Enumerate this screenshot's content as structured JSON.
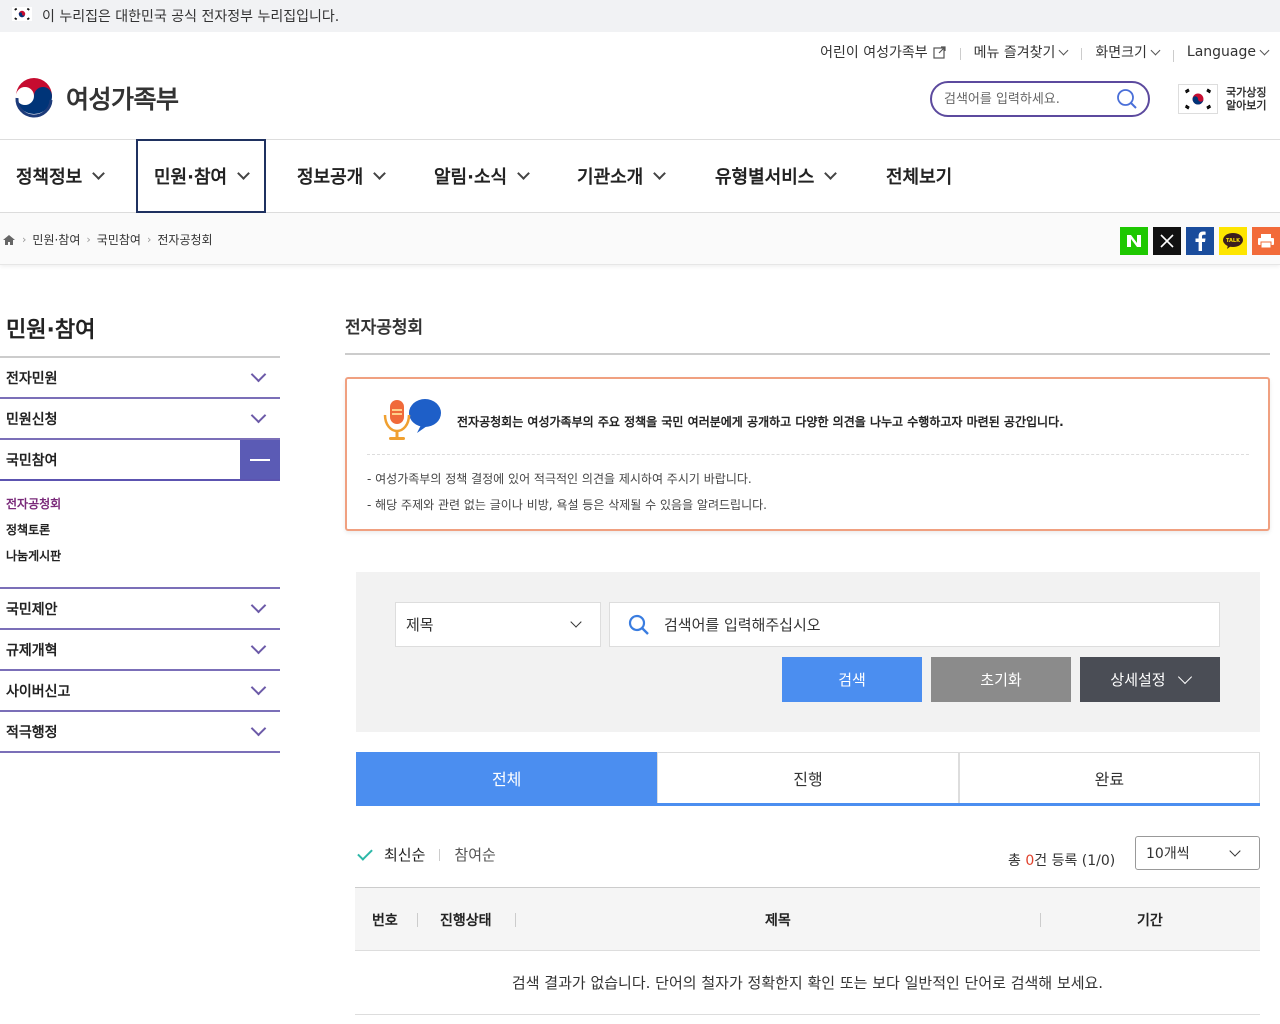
{
  "gov_banner": {
    "text": "이 누리집은 대한민국 공식 전자정부 누리집입니다."
  },
  "utility": {
    "kids": "어린이 여성가족부",
    "favorites": "메뉴 즐겨찾기",
    "screen_size": "화면크기",
    "language": "Language"
  },
  "header": {
    "logo_text": "여성가족부",
    "search_placeholder": "검색어를 입력하세요.",
    "emblem_line1": "국가상징",
    "emblem_line2": "알아보기"
  },
  "gnb": {
    "items": [
      "정책정보",
      "민원·참여",
      "정보공개",
      "알림·소식",
      "기관소개",
      "유형별서비스",
      "전체보기"
    ],
    "active_index": 1
  },
  "breadcrumb": [
    "민원·참여",
    "국민참여",
    "전자공청회"
  ],
  "share_icons": [
    "naver-blog-icon",
    "x-icon",
    "facebook-icon",
    "kakaotalk-icon",
    "print-icon"
  ],
  "lnb": {
    "title": "민원·참여",
    "items": [
      "전자민원",
      "민원신청",
      "국민참여",
      "국민제안",
      "규제개혁",
      "사이버신고",
      "적극행정"
    ],
    "sub_items": [
      "전자공청회",
      "정책토론",
      "나눔게시판"
    ],
    "current_sub": "전자공청회"
  },
  "content": {
    "title": "전자공청회",
    "notice_head": "전자공청회는 여성가족부의 주요 정책을 국민 여러분에게 공개하고 다양한 의견을 나누고 수행하고자 마련된 공간입니다.",
    "notice_line1": "- 여성가족부의 정책 결정에 있어 적극적인 의견을 제시하여 주시기 바랍니다.",
    "notice_line2": "- 해당 주제와 관련 없는 글이나 비방, 욕설 등은 삭제될 수 있음을 알려드립니다."
  },
  "filter": {
    "select_value": "제목",
    "keyword_placeholder": "검색어를 입력해주십시오",
    "search_btn": "검색",
    "reset_btn": "초기화",
    "detail_btn": "상세설정"
  },
  "tabs": [
    "전체",
    "진행",
    "완료"
  ],
  "list": {
    "sort_latest": "최신순",
    "sort_participation": "참여순",
    "count_prefix": "총 ",
    "count_value": "0",
    "count_suffix": "건 등록 (1/0)",
    "per_page": "10개씩",
    "columns": [
      "번호",
      "진행상태",
      "제목",
      "기간"
    ],
    "empty_message": "검색 결과가 없습니다. 단어의 철자가 정확한지 확인 또는 보다 일반적인 단어로 검색해 보세요."
  },
  "colors": {
    "accent_blue": "#4b8ef0",
    "lnb_purple": "#5b5bb5",
    "notice_border": "#f0a080",
    "current_sub": "#7a2a7a"
  }
}
